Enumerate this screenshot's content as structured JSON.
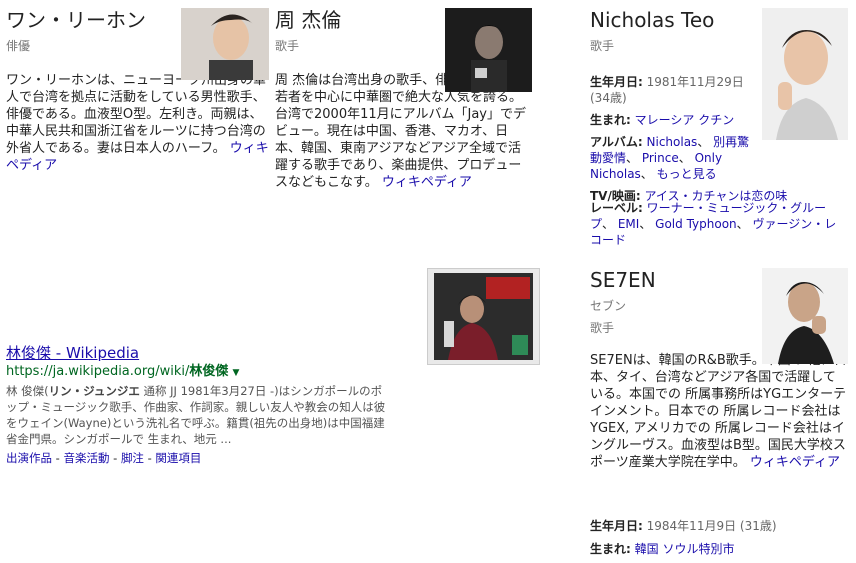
{
  "card1": {
    "name": "ワン・リーホン",
    "role": "俳優",
    "desc": "ワン・リーホンは、ニューヨーク州出身の華人で台湾を拠点に活動をしている男性歌手、俳優である。血液型O型。左利き。両親は、中華人民共和国浙江省をルーツに持つ台湾の外省人である。妻は日本人のハーフ。",
    "wiki": "ウィキペディア"
  },
  "card2": {
    "name": "周 杰倫",
    "role": "歌手",
    "desc": "周 杰倫は台湾出身の歌手、俳優、作曲家。若者を中心に中華圏で絶大な人気を誇る。台湾で2000年11月にアルバム「Jay」でデビュー。現在は中国、香港、マカオ、日本、韓国、東南アジアなどアジア全域で活躍する歌手であり、楽曲提供、プロデュースなどもこなす。",
    "wiki": "ウィキペディア"
  },
  "card3": {
    "name": "Nicholas Teo",
    "role": "歌手",
    "birth_label": "生年月日:",
    "birth_value": "1981年11月29日 (34歳)",
    "born_label": "生まれ:",
    "born_value": "マレーシア クチン",
    "album_label": "アルバム:",
    "album_values": [
      "Nicholas",
      "別再驚動愛情",
      "Prince",
      "Only Nicholas",
      "もっと見る"
    ],
    "tv_label": "TV/映画:",
    "tv_value": "アイス・カチャンは恋の味",
    "label_label": "レーベル:",
    "label_values": [
      "ワーナー・ミュージック・グループ",
      "EMI",
      "Gold Typhoon",
      "ヴァージン・レコード"
    ]
  },
  "card4": {
    "name": "SE7EN",
    "kana": "セブン",
    "role": "歌手",
    "desc": "SE7ENは、韓国のR&B歌手。本国の 他に日本、タイ、台湾などアジア各国で活躍している。本国での 所属事務所はYGエンターテインメント。日本での 所属レコード会社はYGEX, アメリカでの 所属レコード会社はイングルーヴス。血液型はB型。国民大学校スポーツ産業大学院在学中。",
    "wiki": "ウィキペディア",
    "birth_label": "生年月日:",
    "birth_value": "1984年11月9日 (31歳)",
    "born_label": "生まれ:",
    "born_value": "韓国 ソウル特別市"
  },
  "result": {
    "title": "林俊傑 - Wikipedia",
    "url_prefix": "https://ja.wikipedia.org/wiki/",
    "url_bold": "林俊傑",
    "snippet_pre": "林 俊傑(",
    "snippet_bold": "リン・ジュンジエ",
    "snippet_post": " 通称 JJ 1981年3月27日 -)はシンガポールのポップ・ミュージック歌手、作曲家、作詞家。親しい友人や教会の知人は彼をウェイン(Wayne)という洗礼名で呼ぶ。籍貫(祖先の出身地)は中国福建省金門県。シンガポールで 生まれ、地元 ...",
    "links": [
      "出演作品",
      "音楽活動",
      "脚注",
      "関連項目"
    ]
  }
}
